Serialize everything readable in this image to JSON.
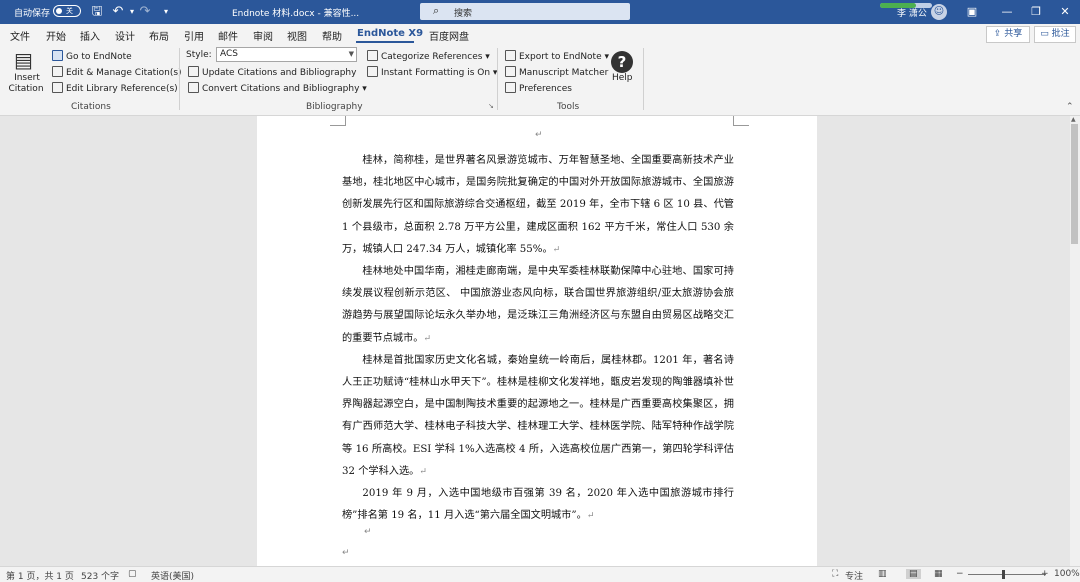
{
  "titlebar": {
    "autosave_label": "自动保存",
    "autosave_state": "关",
    "doc_title": "Endnote 材料.docx  -  兼容性...",
    "search_placeholder": "搜索",
    "user_name": "李 潇公",
    "progress": 0.7
  },
  "menu": {
    "tabs": [
      "文件",
      "开始",
      "插入",
      "设计",
      "布局",
      "引用",
      "邮件",
      "审阅",
      "视图",
      "帮助",
      "EndNote X9",
      "百度网盘"
    ],
    "active_tab": "EndNote X9",
    "share": "共享",
    "comments": "批注"
  },
  "ribbon": {
    "citations": {
      "insert_label_1": "Insert",
      "insert_label_2": "Citation",
      "go_to": "Go to EndNote",
      "edit_manage": "Edit & Manage Citation(s)",
      "edit_library": "Edit Library Reference(s)",
      "group": "Citations"
    },
    "bibliography": {
      "style_label": "Style:",
      "style_value": "ACS",
      "update": "Update Citations and Bibliography",
      "convert": "Convert Citations and Bibliography",
      "categorize": "Categorize References",
      "instant": "Instant Formatting is On",
      "group": "Bibliography"
    },
    "tools": {
      "export": "Export to EndNote",
      "manuscript": "Manuscript Matcher",
      "preferences": "Preferences",
      "help": "Help",
      "group": "Tools"
    }
  },
  "document": {
    "paragraphs": [
      "桂林，简称桂，是世界著名风景游览城市、万年智慧圣地、全国重要高新技术产业基地，桂北地区中心城市，是国务院批复确定的中国对外开放国际旅游城市、全国旅游创新发展先行区和国际旅游综合交通枢纽，截至 2019 年，全市下辖 6 区 10 县、代管 1 个县级市，总面积 2.78 万平方公里，建成区面积 162 平方千米，常住人口 530 余万，城镇人口 247.34 万人，城镇化率 55%。",
      "桂林地处中国华南，湘桂走廊南端，是中央军委桂林联勤保障中心驻地、国家可持续发展议程创新示范区、 中国旅游业态风向标，联合国世界旅游组织/亚太旅游协会旅游趋势与展望国际论坛永久举办地，是泛珠江三角洲经济区与东盟自由贸易区战略交汇的重要节点城市。",
      "桂林是首批国家历史文化名城，秦始皇统一岭南后，属桂林郡。1201 年，著名诗人王正功赋诗“桂林山水甲天下”。桂林是桂柳文化发祥地，甑皮岩发现的陶雏器填补世界陶器起源空白，是中国制陶技术重要的起源地之一。桂林是广西重要高校集聚区，拥有广西师范大学、桂林电子科技大学、桂林理工大学、桂林医学院、陆军特种作战学院等 16 所高校。ESI 学科 1%入选高校 4 所，入选高校位居广西第一，第四轮学科评估 32 个学科入选。",
      "2019 年 9 月，入选中国地级市百强第 39 名，2020 年入选中国旅游城市排行榜”排名第 19 名，11 月入选“第六届全国文明城市”。"
    ],
    "para_mark": "↵"
  },
  "status": {
    "page": "第 1 页，共 1 页",
    "words": "523 个字",
    "language": "英语(美国)",
    "focus": "专注",
    "zoom": "100%"
  }
}
